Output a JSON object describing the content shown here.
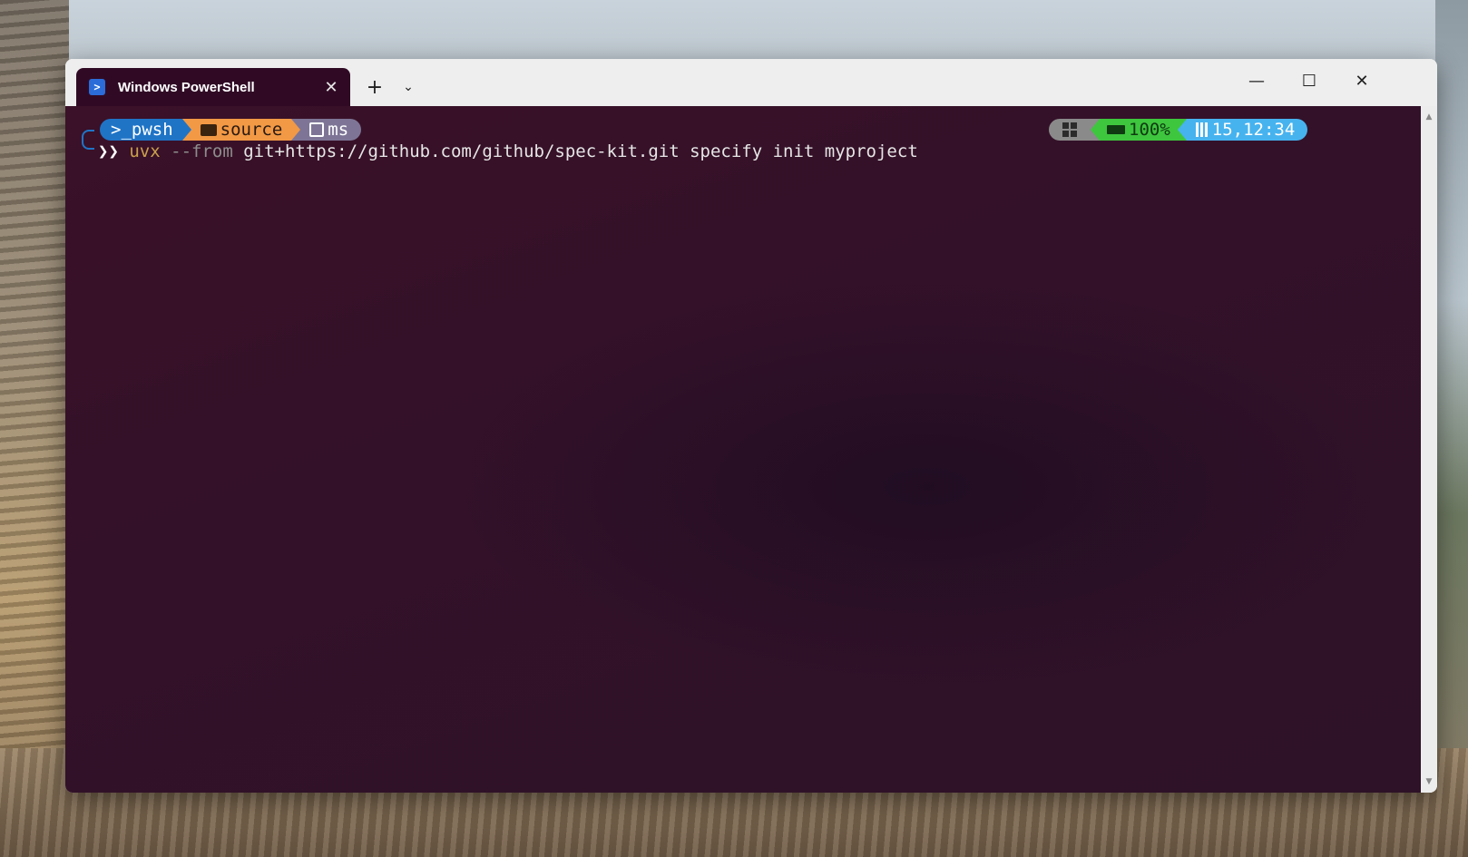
{
  "window": {
    "tab_title": "Windows PowerShell",
    "tab_icon": "powershell-icon",
    "tab_close_icon": "close-icon",
    "new_tab_icon": "plus-icon",
    "dropdown_icon": "chevron-down-icon",
    "minimize_icon": "minimize-icon",
    "maximize_icon": "maximize-icon",
    "close_icon": "close-icon"
  },
  "prompt": {
    "shell_segment": ">_pwsh",
    "folder_segment": "source",
    "git_segment": "ms",
    "chevron": "❯❯",
    "colors": {
      "shell_bg": "#1f74c6",
      "folder_bg": "#f29945",
      "git_bg": "#7e7596"
    }
  },
  "command": {
    "program": "uvx",
    "flag": "--from",
    "rest": "git+https://github.com/github/spec-kit.git specify init myproject"
  },
  "status": {
    "os_icon": "windows-icon",
    "battery_icon": "battery-icon",
    "battery": "100%",
    "calendar_icon": "calendar-icon",
    "datetime": "15,12:34",
    "colors": {
      "os_bg": "#8a8a8a",
      "battery_bg": "#3ec63e",
      "time_bg": "#46b3ef"
    }
  },
  "terminal": {
    "background": "#300a24"
  }
}
